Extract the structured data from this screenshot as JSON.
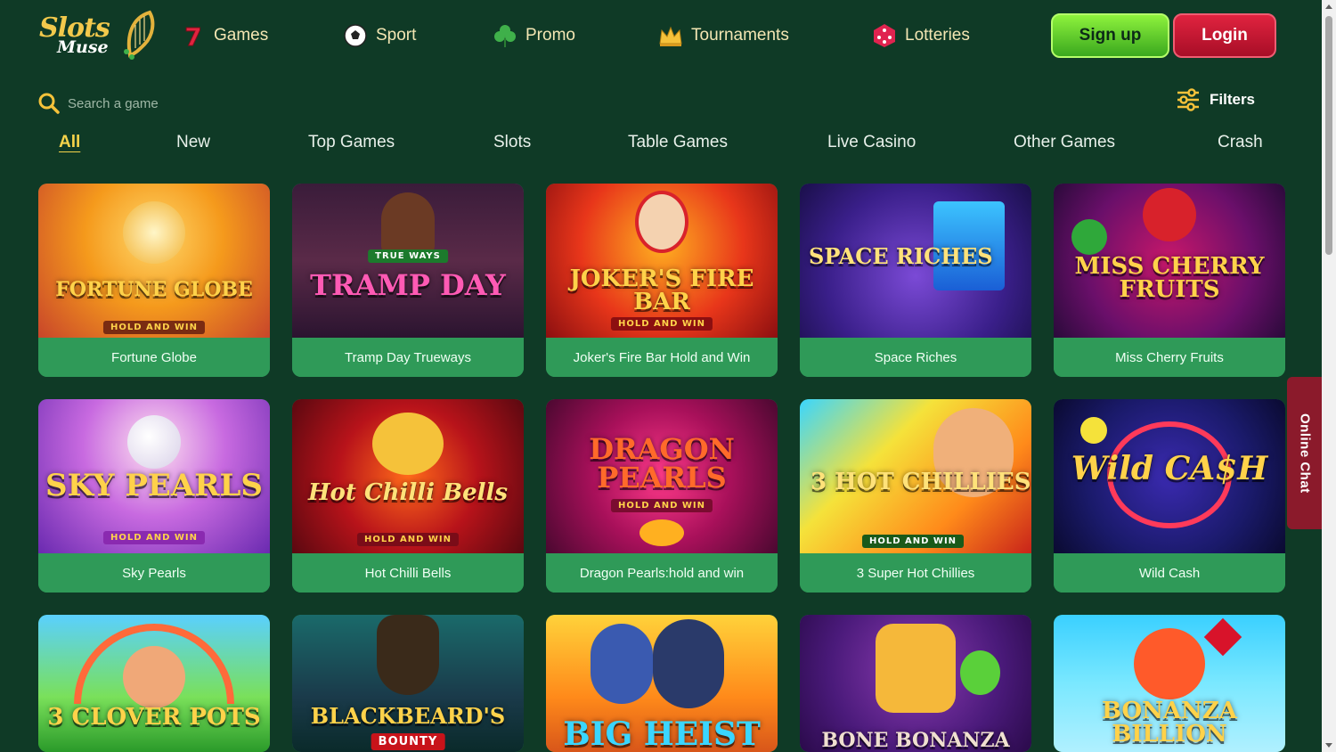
{
  "brand": {
    "logo_line1": "Slots",
    "logo_line2": "Muse",
    "colors": {
      "background": "#0f3a26",
      "accent_gold": "#f5d34a",
      "caption_green": "#2f9a58",
      "signup_green": "#6fd82e",
      "login_red": "#c8152f"
    }
  },
  "nav": [
    {
      "label": "Games",
      "icon": "lucky-seven-icon"
    },
    {
      "label": "Sport",
      "icon": "soccer-ball-icon"
    },
    {
      "label": "Promo",
      "icon": "clover-icon"
    },
    {
      "label": "Tournaments",
      "icon": "crown-icon"
    },
    {
      "label": "Lotteries",
      "icon": "dice-icon"
    }
  ],
  "auth": {
    "signup_label": "Sign up",
    "login_label": "Login"
  },
  "search": {
    "placeholder": "Search a game",
    "icon": "search-icon"
  },
  "filters": {
    "label": "Filters",
    "icon": "sliders-icon"
  },
  "tabs": [
    {
      "label": "All",
      "active": true
    },
    {
      "label": "New",
      "active": false
    },
    {
      "label": "Top Games",
      "active": false
    },
    {
      "label": "Slots",
      "active": false
    },
    {
      "label": "Table Games",
      "active": false
    },
    {
      "label": "Live Casino",
      "active": false
    },
    {
      "label": "Other Games",
      "active": false
    },
    {
      "label": "Crash",
      "active": false
    }
  ],
  "games": [
    {
      "name": "Fortune Globe",
      "art_title": "FORTUNE GLOBE",
      "art_sub": "HOLD AND WIN"
    },
    {
      "name": "Tramp Day Trueways",
      "art_title": "TRAMP DAY",
      "art_sub": "TRUE WAYS"
    },
    {
      "name": "Joker's Fire Bar Hold and Win",
      "art_title": "JOKER'S FIRE BAR",
      "art_sub": "HOLD AND WIN"
    },
    {
      "name": "Space Riches",
      "art_title": "SPACE RICHES",
      "art_sub": ""
    },
    {
      "name": "Miss Cherry Fruits",
      "art_title": "MISS CHERRY FRUITS",
      "art_sub": ""
    },
    {
      "name": "Sky Pearls",
      "art_title": "SKY PEARLS",
      "art_sub": "HOLD AND WIN"
    },
    {
      "name": "Hot Chilli Bells",
      "art_title": "Hot Chilli Bells",
      "art_sub": "HOLD AND WIN"
    },
    {
      "name": "Dragon Pearls:hold and win",
      "art_title": "DRAGON PEARLS",
      "art_sub": "HOLD AND WIN"
    },
    {
      "name": "3 Super Hot Chillies",
      "art_title": "3 HOT CHILLIES",
      "art_sub": "HOLD AND WIN"
    },
    {
      "name": "Wild Cash",
      "art_title": "Wild CA$H",
      "art_sub": ""
    },
    {
      "name": "",
      "art_title": "3 CLOVER POTS",
      "art_sub": ""
    },
    {
      "name": "",
      "art_title": "BLACKBEARD'S",
      "art_sub": "BOUNTY"
    },
    {
      "name": "",
      "art_title": "BIG HEIST",
      "art_sub": ""
    },
    {
      "name": "",
      "art_title": "BONE BONANZA",
      "art_sub": ""
    },
    {
      "name": "",
      "art_title": "BONANZA BILLION",
      "art_sub": ""
    }
  ],
  "chat": {
    "label": "Online Chat"
  }
}
